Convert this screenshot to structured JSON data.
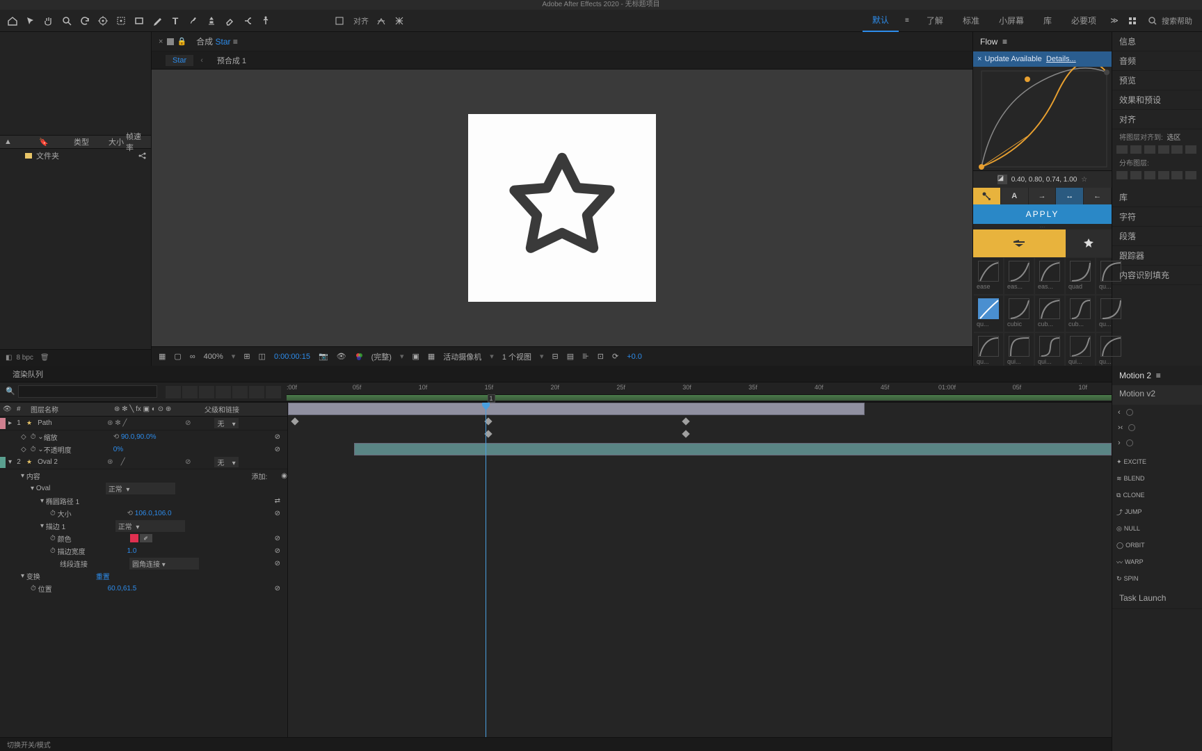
{
  "app": {
    "title": "Adobe After Effects 2020 - 无标题项目"
  },
  "toolbar": {
    "align_label": "对齐",
    "workspaces": [
      "默认",
      "了解",
      "标准",
      "小屏幕",
      "库",
      "必要项"
    ],
    "active_ws": 0,
    "search_help": "搜索帮助"
  },
  "project": {
    "columns": [
      "类型",
      "大小",
      "帧速率"
    ],
    "items": [
      {
        "name": "文件夹"
      }
    ],
    "footer": "8 bpc"
  },
  "composition": {
    "tab": "合成",
    "tab_sub": "Star",
    "breadcrumbs": [
      "Star",
      "预合成 1"
    ]
  },
  "viewer_bar": {
    "zoom": "400%",
    "timecode": "0:00:00:15",
    "resolution": "(完整)",
    "camera": "活动摄像机",
    "view_count": "1 个视图",
    "exposure": "+0.0"
  },
  "flow": {
    "title": "Flow",
    "update_x": "×",
    "update": "Update Available",
    "details": "Details...",
    "bezier": "0.40, 0.80, 0.74, 1.00",
    "apply": "APPLY",
    "curves_row1": [
      "ease",
      "eas...",
      "eas...",
      "quad",
      "qu..."
    ],
    "curves_row2": [
      "qu...",
      "cubic",
      "cub...",
      "cub...",
      "qu..."
    ],
    "curves_row3": [
      "qu...",
      "qui...",
      "qui...",
      "qui...",
      "qu..."
    ]
  },
  "side": {
    "items": [
      "信息",
      "音频",
      "预览",
      "效果和预设",
      "对齐"
    ],
    "align_to_label": "将图层对齐到:",
    "align_to_value": "选区",
    "distribute_label": "分布图层:",
    "items2": [
      "库",
      "字符",
      "段落",
      "跟踪器",
      "内容识别填充"
    ]
  },
  "timeline": {
    "tab": "渲染队列",
    "header": {
      "idx": "#",
      "name": "图层名称",
      "parent": "父级和链接"
    },
    "ruler": [
      ":00f",
      "05f",
      "10f",
      "15f",
      "20f",
      "25f",
      "30f",
      "35f",
      "40f",
      "45f",
      "01:00f",
      "05f",
      "10f"
    ],
    "layer1": {
      "idx": "1",
      "name": "Path",
      "parent": "无"
    },
    "layer1_props": {
      "scale_name": "缩放",
      "scale_val": "90.0,90.0%",
      "opacity_name": "不透明度",
      "opacity_val": "0%"
    },
    "layer2": {
      "idx": "2",
      "name": "Oval 2",
      "parent": "无"
    },
    "layer2_props": {
      "contents": "内容",
      "add": "添加:",
      "oval": "Oval",
      "oval_mode": "正常",
      "ellipse": "椭圆路径 1",
      "size_name": "大小",
      "size_val": "106.0,106.0",
      "stroke": "描边 1",
      "stroke_mode": "正常",
      "color_name": "颜色",
      "width_name": "描边宽度",
      "width_val": "1.0",
      "join_name": "线段连接",
      "join_val": "圆角连接",
      "transform": "变换",
      "reset": "重置",
      "pos_name": "位置",
      "pos_val": "60.0,61.5"
    },
    "bottom": "切换开关/模式"
  },
  "motion": {
    "title": "Motion 2",
    "subtitle": "Motion v2",
    "buttons": [
      "EXCITE",
      "BLEND",
      "CLONE",
      "JUMP",
      "NULL",
      "ORBIT",
      "WARP",
      "SPIN"
    ],
    "task": "Task Launch"
  }
}
